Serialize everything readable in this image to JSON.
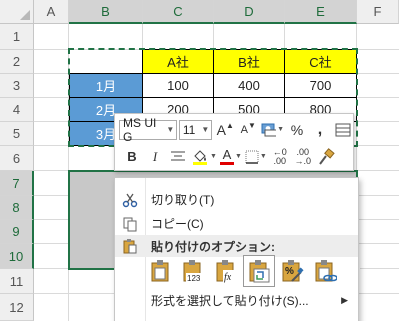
{
  "columns": [
    "A",
    "B",
    "C",
    "D",
    "E",
    "F"
  ],
  "rows": [
    "1",
    "2",
    "3",
    "4",
    "5",
    "6",
    "7",
    "8",
    "9",
    "10",
    "11",
    "12"
  ],
  "table": {
    "headers": [
      "A社",
      "B社",
      "C社"
    ],
    "months": [
      "1月",
      "2月",
      "3月"
    ],
    "values": [
      [
        "100",
        "400",
        "700"
      ],
      [
        "200",
        "500",
        "800"
      ]
    ]
  },
  "mini_toolbar": {
    "font_name": "MS UI G",
    "font_size": "11",
    "grow_font": "A",
    "shrink_font": "A",
    "percent": "%",
    "comma": ",",
    "bold": "B",
    "italic": "I",
    "font_color_letter": "A",
    "inc_decimal": ".00 .0",
    "dec_decimal": ".00 .0"
  },
  "context_menu": {
    "cut": "切り取り(T)",
    "copy": "コピー(C)",
    "paste_options": "貼り付けのオプション:",
    "paste_special": "形式を選択して貼り付け(S)..."
  },
  "colors": {
    "accent": "#217346",
    "header_yellow": "#ffff00",
    "month_blue": "#5b9bd5",
    "paste_gray": "#c8c8c8"
  }
}
